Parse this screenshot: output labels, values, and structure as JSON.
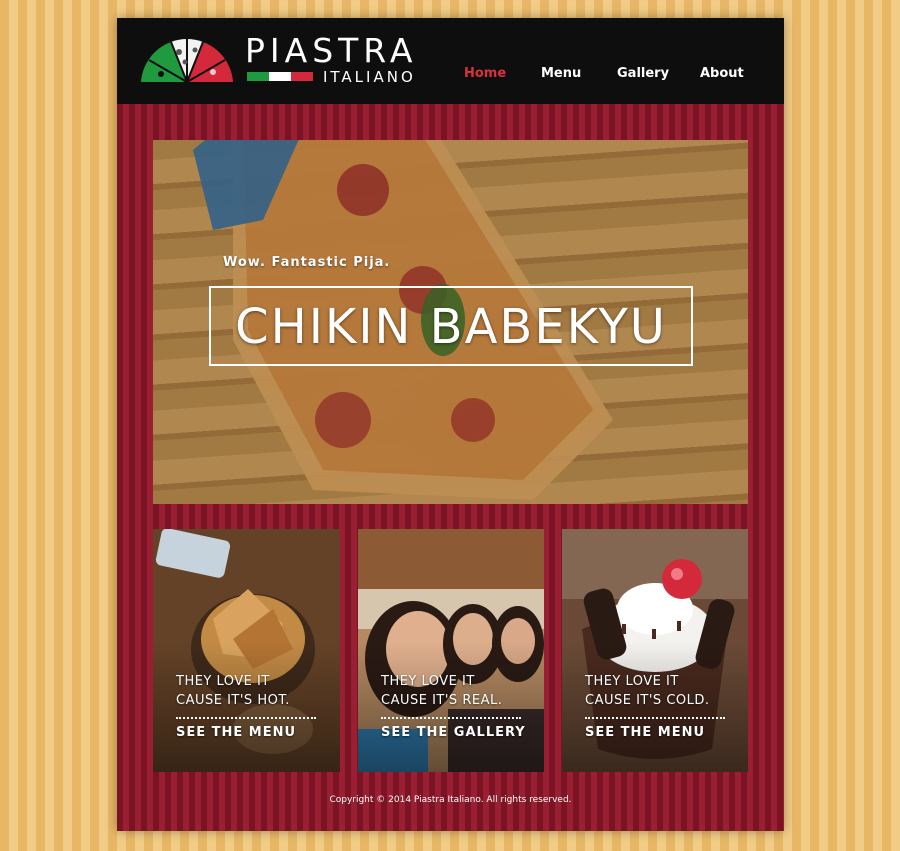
{
  "brand": {
    "name": "PIASTRA",
    "subtitle": "ITALIANO",
    "colors": {
      "green": "#1f9a3f",
      "white": "#ffffff",
      "red": "#d3293a"
    }
  },
  "nav": {
    "items": [
      {
        "label": "Home",
        "active": true
      },
      {
        "label": "Menu",
        "active": false
      },
      {
        "label": "Gallery",
        "active": false
      },
      {
        "label": "About",
        "active": false
      }
    ]
  },
  "hero": {
    "tagline": "Wow. Fantastic Pija.",
    "title": "CHIKIN BABEKYU"
  },
  "cards": [
    {
      "line1": "They love it",
      "line2": "cause it's hot.",
      "link": "SEE THE MENU"
    },
    {
      "line1": "They love it",
      "line2": "cause it's real.",
      "link": "SEE THE GALLERY"
    },
    {
      "line1": "They love it",
      "line2": "cause it's cold.",
      "link": "SEE THE MENU"
    }
  ],
  "footer": {
    "copyright": "Copyright © 2014 Piastra Italiano. All rights reserved."
  },
  "theme": {
    "nav_active": "#d9323f",
    "header_bg": "#0e0e0e",
    "stripe_dark": "#7a1424",
    "stripe_light": "#9b1f33"
  }
}
